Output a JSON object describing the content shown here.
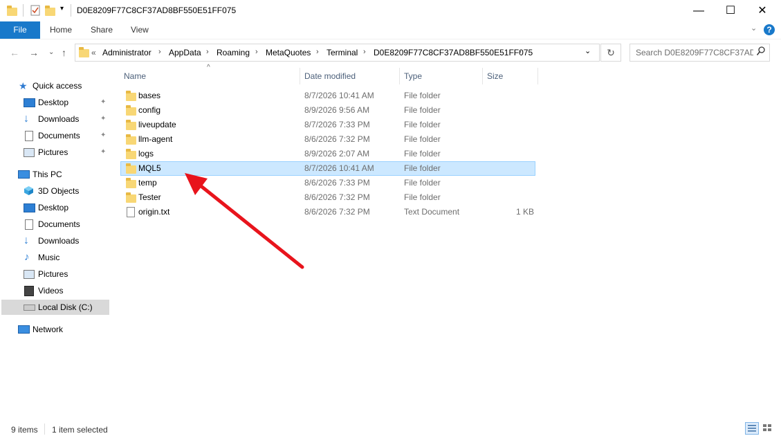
{
  "window": {
    "title": "D0E8209F77C8CF37AD8BF550E51FF075",
    "minimize": "—",
    "maximize": "☐",
    "close": "✕",
    "qa_dropdown": "▾"
  },
  "ribbon": {
    "tabs": [
      "File",
      "Home",
      "Share",
      "View"
    ],
    "help": "?",
    "expand": "⌄"
  },
  "nav": {
    "back": "←",
    "forward": "→",
    "recent": "⌄",
    "up": "↑",
    "overflow": "«",
    "breadcrumb": [
      "Administrator",
      "AppData",
      "Roaming",
      "MetaQuotes",
      "Terminal",
      "D0E8209F77C8CF37AD8BF550E51FF075"
    ],
    "separator": "›",
    "dropdown": "⌄",
    "refresh": "↻",
    "search_placeholder": "Search D0E8209F77C8CF37AD...",
    "search_icon": "⌕"
  },
  "sidebar": {
    "items": [
      {
        "label": "Quick access",
        "icon": "star-icon",
        "pinned": false
      },
      {
        "label": "Desktop",
        "icon": "desktop-icon",
        "pinned": true
      },
      {
        "label": "Downloads",
        "icon": "download-icon",
        "pinned": true
      },
      {
        "label": "Documents",
        "icon": "documents-icon",
        "pinned": true
      },
      {
        "label": "Pictures",
        "icon": "pictures-icon",
        "pinned": true
      },
      {
        "label": "This PC",
        "icon": "computer-icon",
        "pinned": false
      },
      {
        "label": "3D Objects",
        "icon": "cube-icon",
        "pinned": false
      },
      {
        "label": "Desktop",
        "icon": "desktop-icon",
        "pinned": false
      },
      {
        "label": "Documents",
        "icon": "documents-icon",
        "pinned": false
      },
      {
        "label": "Downloads",
        "icon": "download-icon",
        "pinned": false
      },
      {
        "label": "Music",
        "icon": "music-icon",
        "pinned": false
      },
      {
        "label": "Pictures",
        "icon": "pictures-icon",
        "pinned": false
      },
      {
        "label": "Videos",
        "icon": "videos-icon",
        "pinned": false
      },
      {
        "label": "Local Disk (C:)",
        "icon": "drive-icon",
        "pinned": false,
        "selected": true
      },
      {
        "label": "Network",
        "icon": "network-icon",
        "pinned": false
      }
    ],
    "pin_glyph": "📌"
  },
  "columns": {
    "name": "Name",
    "date": "Date modified",
    "type": "Type",
    "size": "Size",
    "sort_indicator": "^"
  },
  "files": [
    {
      "name": "bases",
      "date": "8/7/2026 10:41 AM",
      "type": "File folder",
      "size": "",
      "kind": "folder"
    },
    {
      "name": "config",
      "date": "8/9/2026 9:56 AM",
      "type": "File folder",
      "size": "",
      "kind": "folder"
    },
    {
      "name": "liveupdate",
      "date": "8/7/2026 7:33 PM",
      "type": "File folder",
      "size": "",
      "kind": "folder"
    },
    {
      "name": "llm-agent",
      "date": "8/6/2026 7:32 PM",
      "type": "File folder",
      "size": "",
      "kind": "folder"
    },
    {
      "name": "logs",
      "date": "8/9/2026 2:07 AM",
      "type": "File folder",
      "size": "",
      "kind": "folder"
    },
    {
      "name": "MQL5",
      "date": "8/7/2026 10:41 AM",
      "type": "File folder",
      "size": "",
      "kind": "folder",
      "selected": true
    },
    {
      "name": "temp",
      "date": "8/6/2026 7:33 PM",
      "type": "File folder",
      "size": "",
      "kind": "folder"
    },
    {
      "name": "Tester",
      "date": "8/6/2026 7:32 PM",
      "type": "File folder",
      "size": "",
      "kind": "folder"
    },
    {
      "name": "origin.txt",
      "date": "8/6/2026 7:32 PM",
      "type": "Text Document",
      "size": "1 KB",
      "kind": "text"
    }
  ],
  "status": {
    "items": "9 items",
    "selected": "1 item selected"
  },
  "colors": {
    "accent": "#1979ca",
    "selection_bg": "#cce8ff",
    "selection_border": "#99d1ff",
    "folder": "#f8d775",
    "annotation_arrow": "#e8141c"
  }
}
